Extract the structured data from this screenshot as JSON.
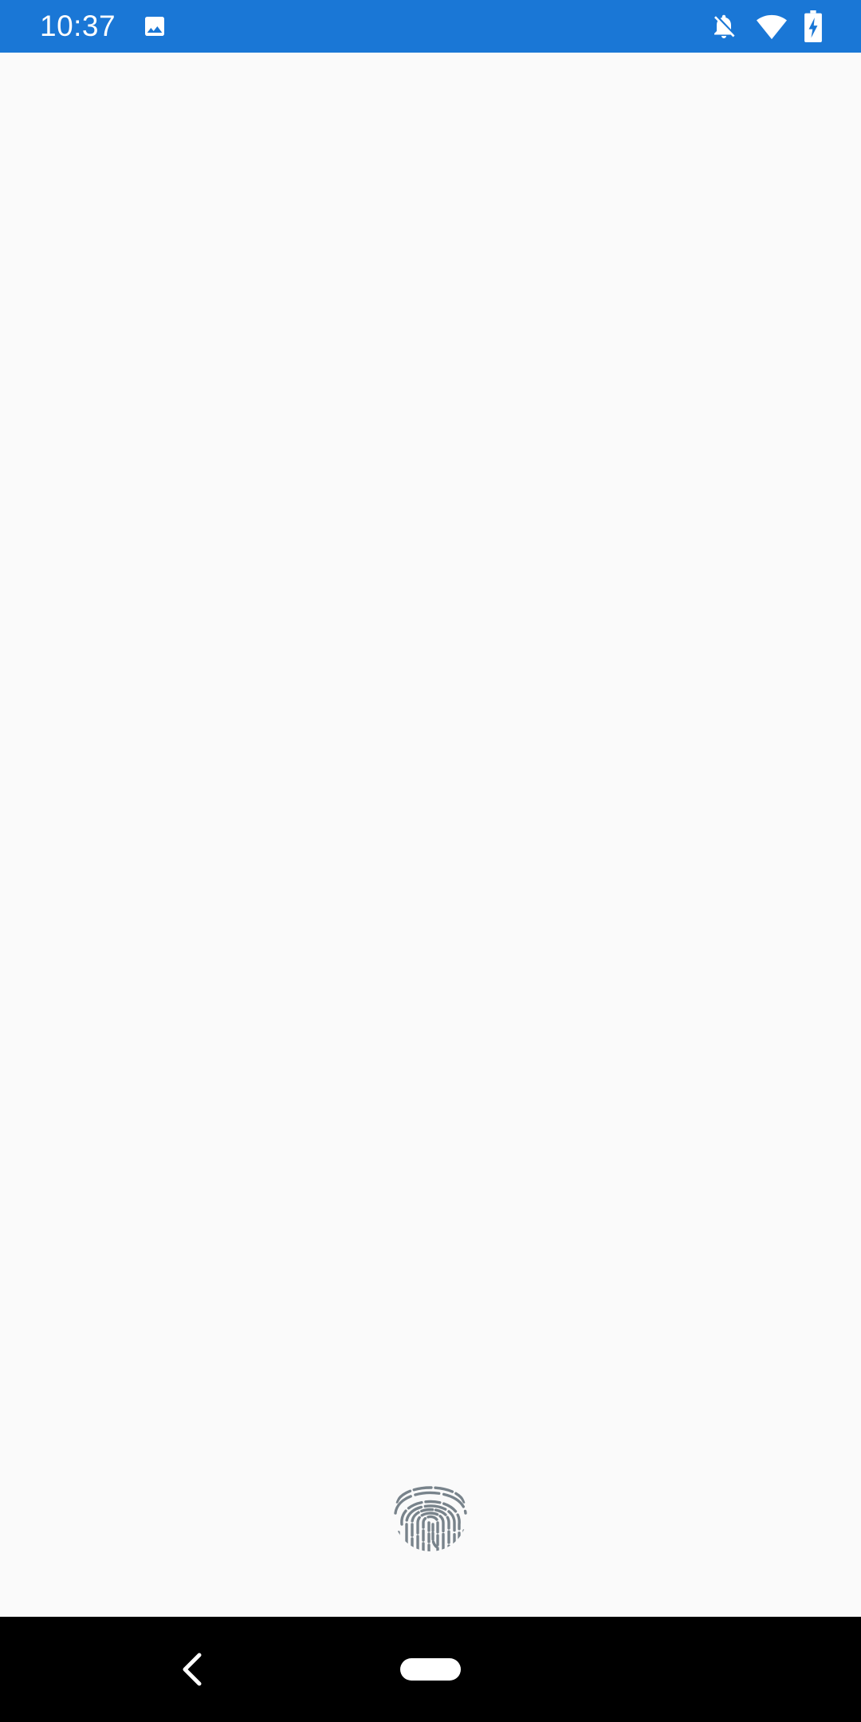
{
  "status_bar": {
    "time": "10:37",
    "background_color": "#1a77d6",
    "icons": [
      "image-notification-icon",
      "notifications-off-icon",
      "wifi-icon",
      "battery-charging-icon"
    ]
  },
  "content": {
    "background_color": "#fafafa",
    "fingerprint_icon": "fingerprint-icon",
    "fingerprint_color": "#78838b"
  },
  "nav_bar": {
    "background_color": "#000000",
    "buttons": [
      "back-icon",
      "home-pill"
    ]
  }
}
